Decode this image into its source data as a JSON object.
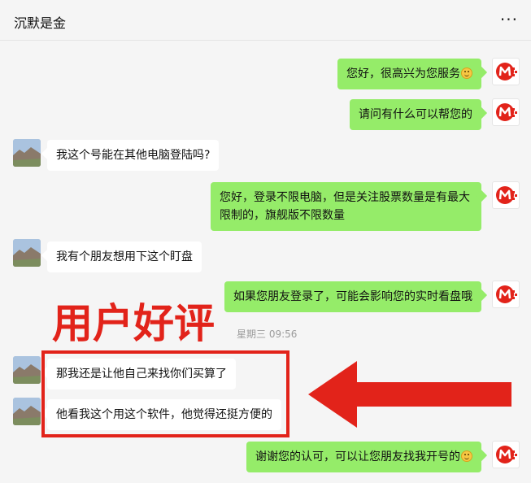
{
  "header": {
    "title": "沉默是金",
    "more_icon": "more-horizontal-icon"
  },
  "messages": [
    {
      "side": "out",
      "text": "您好，很高兴为您服务",
      "emoji": "smile-emoji"
    },
    {
      "side": "out",
      "text": "请问有什么可以帮您的"
    },
    {
      "side": "in",
      "text": "我这个号能在其他电脑登陆吗?"
    },
    {
      "side": "out",
      "text": "您好，登录不限电脑，但是关注股票数量是有最大限制的，旗舰版不限数量"
    },
    {
      "side": "in",
      "text": "我有个朋友想用下这个盯盘"
    },
    {
      "side": "out",
      "text": "如果您朋友登录了，可能会影响您的实时看盘哦"
    },
    {
      "side": "in",
      "text": "那我还是让他自己来找你们买算了"
    },
    {
      "side": "in",
      "text": "他看我这个用这个软件，他觉得还挺方便的"
    },
    {
      "side": "out",
      "text": "谢谢您的认可，可以让您朋友找我开号的",
      "emoji": "smile-emoji"
    }
  ],
  "timestamp": "星期三 09:56",
  "annotation": {
    "label": "用户好评",
    "color": "#e2231a"
  },
  "colors": {
    "outgoing_bubble": "#95ec69",
    "incoming_bubble": "#ffffff",
    "background": "#f5f5f5",
    "brand_logo": "#e2231a"
  }
}
